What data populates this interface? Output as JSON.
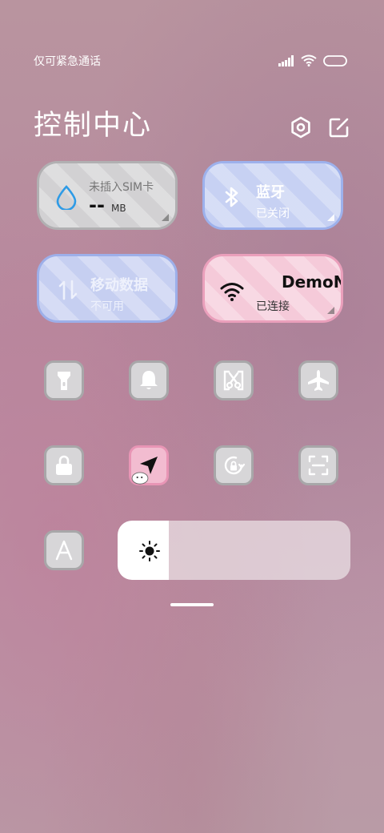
{
  "status_bar": {
    "carrier": "仅可紧急通话",
    "icons": [
      "signal-icon",
      "wifi-icon",
      "battery-icon"
    ]
  },
  "header": {
    "title": "控制中心",
    "settings_icon": "settings-icon",
    "edit_icon": "edit-icon"
  },
  "tiles": {
    "data_usage": {
      "label": "未插入SIM卡",
      "value": "--",
      "unit": "MB",
      "icon": "water-drop-icon"
    },
    "bluetooth": {
      "label": "蓝牙",
      "status": "已关闭",
      "icon": "bluetooth-icon"
    },
    "mobile_data": {
      "label": "移动数据",
      "status": "不可用",
      "icon": "data-arrows-icon"
    },
    "wifi": {
      "label": "DemoN",
      "status": "已连接",
      "icon": "wifi-icon"
    }
  },
  "toggles_row1": [
    "flashlight-icon",
    "bell-icon",
    "screenshot-icon",
    "airplane-icon"
  ],
  "toggles_row2": [
    "lock-icon",
    "location-icon",
    "rotation-lock-icon",
    "scanner-icon"
  ],
  "auto_brightness_icon": "font-a-icon",
  "brightness": {
    "level": 0.22,
    "icon": "sun-icon"
  },
  "colors": {
    "tile_gray": "#cfcfd1",
    "tile_blue": "#c8d2f2",
    "tile_pink": "#f4cbd9",
    "location_active": "#f2bcd0",
    "water_drop": "#2e9be6"
  }
}
